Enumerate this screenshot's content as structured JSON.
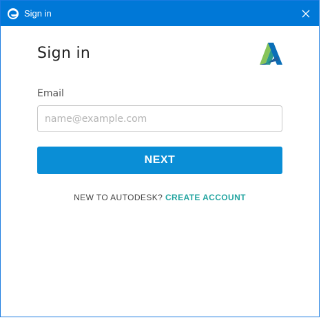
{
  "window": {
    "title": "Sign in",
    "app_icon": "edge-browser-icon",
    "close_icon": "close-icon"
  },
  "form": {
    "heading": "Sign in",
    "logo": "autodesk-logo",
    "email_label": "Email",
    "email_placeholder": "name@example.com",
    "email_value": "",
    "next_label": "NEXT"
  },
  "footer": {
    "prompt": "NEW TO AUTODESK?",
    "create_account_label": "CREATE ACCOUNT"
  },
  "colors": {
    "titlebar": "#0078d7",
    "primary_button": "#0a8ed6",
    "link": "#24a5a1"
  }
}
